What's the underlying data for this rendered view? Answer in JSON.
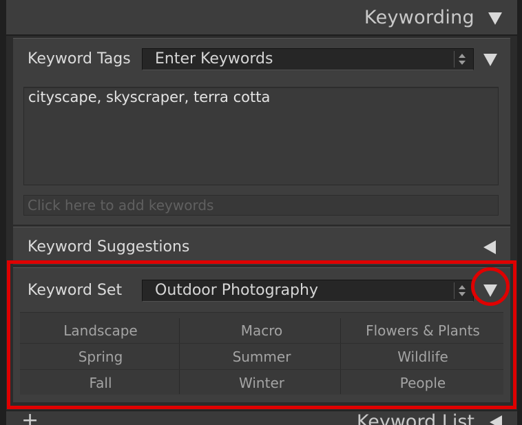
{
  "panel": {
    "title": "Keywording"
  },
  "keyword_tags": {
    "label": "Keyword Tags",
    "mode": "Enter Keywords",
    "tags_text": "cityscape, skyscraper, terra cotta",
    "add_placeholder": "Click here to add keywords"
  },
  "keyword_suggestions": {
    "label": "Keyword Suggestions"
  },
  "keyword_set": {
    "label": "Keyword Set",
    "selected": "Outdoor Photography",
    "keywords": [
      [
        "Landscape",
        "Macro",
        "Flowers & Plants"
      ],
      [
        "Spring",
        "Summer",
        "Wildlife"
      ],
      [
        "Fall",
        "Winter",
        "People"
      ]
    ]
  },
  "next_panel": {
    "title": "Keyword List",
    "add_symbol": "+"
  },
  "colors": {
    "highlight": "#e00000",
    "panel_bg": "#3e3e3e",
    "text": "#dcdcdc"
  },
  "icons": {
    "collapse": "triangle-down-icon",
    "expand": "triangle-left-icon",
    "spinner": "up-down-spinner-icon"
  }
}
